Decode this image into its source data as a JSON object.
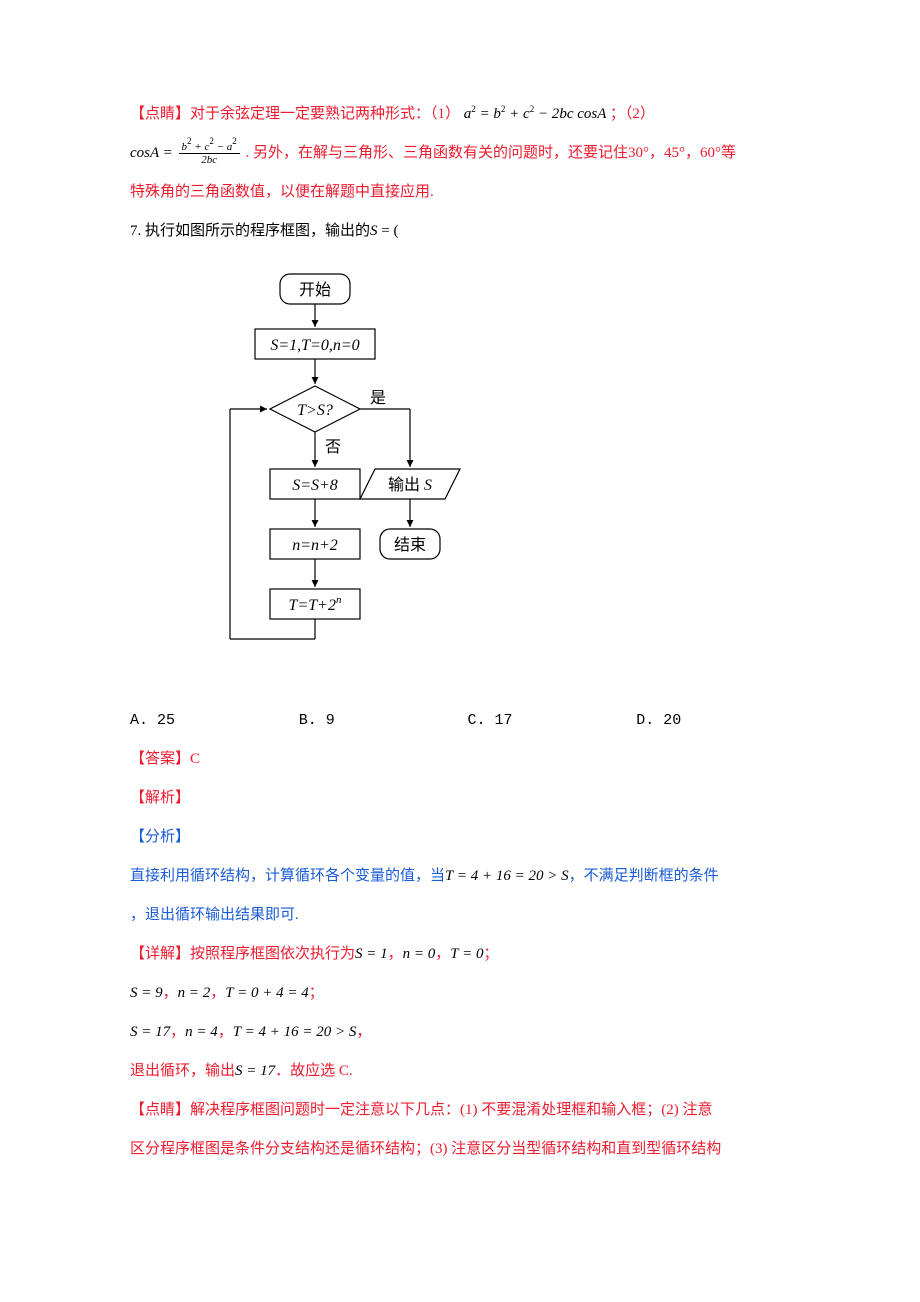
{
  "p1_a": "【点睛】对于余弦定理一定要熟记两种形式：（1）",
  "p1_f1_lhs": "a",
  "p1_f1_eq": " = ",
  "p1_f1_rhs": "b² + c² − 2bc cosA",
  "p1_b": "；（2）",
  "p2_a": "cosA = ",
  "p2_frac_num": "b² + c² − a²",
  "p2_frac_den": "2bc",
  "p2_b": ". 另外，在解与三角形、三角函数有关的问题时，还要记住30°，45°，60°等",
  "p3": "特殊角的三角函数值，以便在解题中直接应用.",
  "q7": "7. 执行如图所示的程序框图，输出的S = (",
  "diagram": {
    "start": "开始",
    "init": "S=1,T=0,n=0",
    "cond": "T>S?",
    "yes": "是",
    "no": "否",
    "out": "输出 S",
    "end": "结束",
    "b1": "S=S+8",
    "b2": "n=n+2",
    "b3": "T=T+2",
    "b3_sup": "n"
  },
  "optA": "A.  25",
  "optB": "B.  9",
  "optC": "C.  17",
  "optD": "D.  20",
  "ans": "【答案】C",
  "jx": "【解析】",
  "fx": "【分析】",
  "l1": "直接利用循环结构，计算循环各个变量的值，当T = 4 + 16 = 20 > S，不满足判断框的条件",
  "l2": "，退出循环输出结果即可.",
  "l3_a": "【详解】按照程序框图依次执行为",
  "l3_b": "S = 1，n = 0，T = 0；",
  "l4": "S = 9，n = 2，T = 0 + 4 = 4；",
  "l5": "S = 17，n = 4，T = 4 + 16 = 20 > S，",
  "l6": "退出循环，输出S = 17．故应选 C.",
  "l7": "【点睛】解决程序框图问题时一定注意以下几点：(1) 不要混淆处理框和输入框；(2) 注意",
  "l8": "区分程序框图是条件分支结构还是循环结构；(3) 注意区分当型循环结构和直到型循环结构"
}
